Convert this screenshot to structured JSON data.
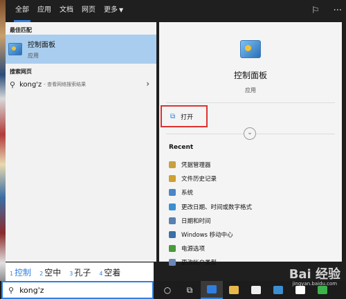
{
  "nav": {
    "tabs": [
      "全部",
      "应用",
      "文档",
      "网页",
      "更多"
    ],
    "active_tab": "全部"
  },
  "left": {
    "best_match_title": "最佳匹配",
    "best_match": {
      "name": "控制面板",
      "type": "应用"
    },
    "web_title": "搜索网页",
    "web_result": {
      "query": "kong'z",
      "hint": "- 查看网络搜索结果"
    }
  },
  "right": {
    "app_name": "控制面板",
    "app_type": "应用",
    "open_label": "打开",
    "recent_title": "Recent",
    "recent": [
      {
        "label": "凭据管理器",
        "color": "#c8a040"
      },
      {
        "label": "文件历史记录",
        "color": "#d0a030"
      },
      {
        "label": "系统",
        "color": "#4a86c8"
      },
      {
        "label": "更改日期、时间或数字格式",
        "color": "#3a8fd0"
      },
      {
        "label": "日期和时间",
        "color": "#5a7fb0"
      },
      {
        "label": "Windows 移动中心",
        "color": "#3b6fa8"
      },
      {
        "label": "电源选项",
        "color": "#4a9a3a"
      },
      {
        "label": "更改帐户类型",
        "color": "#6a88b8"
      }
    ]
  },
  "ime": {
    "candidates": [
      {
        "num": "1",
        "text": "控制"
      },
      {
        "num": "2",
        "text": "空中"
      },
      {
        "num": "3",
        "text": "孔子"
      },
      {
        "num": "4",
        "text": "空着"
      }
    ]
  },
  "taskbar": {
    "search_text": "kong'z"
  },
  "watermark": {
    "main": "Bai 经验",
    "sub": "jingyan.baidu.com"
  },
  "colors": {
    "accent": "#2f7fe0",
    "selection": "#a9cdee",
    "highlight_border": "#e03030"
  }
}
